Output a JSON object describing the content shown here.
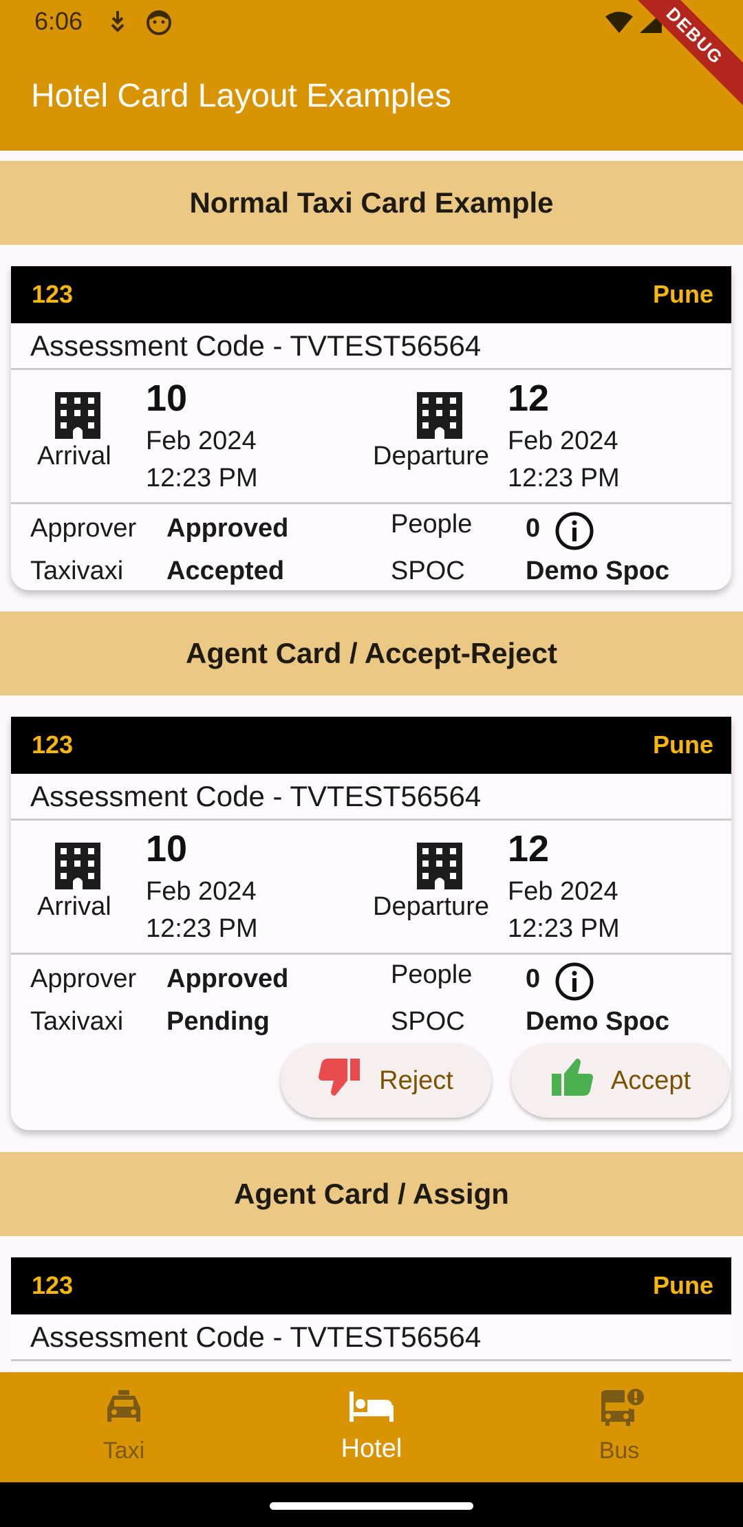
{
  "status": {
    "time": "6:06",
    "debug": "DEBUG"
  },
  "appbar": {
    "title": "Hotel Card Layout Examples"
  },
  "sections": [
    {
      "header": "Normal Taxi Card Example"
    },
    {
      "header": "Agent Card / Accept-Reject"
    },
    {
      "header": "Agent Card / Assign"
    }
  ],
  "cards": [
    {
      "number": "123",
      "city": "Pune",
      "assessment": "Assessment Code - TVTEST56564",
      "arrival": {
        "label": "Arrival",
        "day": "10",
        "month": "Feb 2024",
        "time": "12:23 PM"
      },
      "departure": {
        "label": "Departure",
        "day": "12",
        "month": "Feb 2024",
        "time": "12:23 PM"
      },
      "approver_label": "Approver",
      "approver_value": "Approved",
      "taxi_label": "Taxivaxi",
      "taxi_value": "Accepted",
      "people_label": "People",
      "people_value": "0",
      "spoc_label": "SPOC",
      "spoc_value": "Demo Spoc"
    },
    {
      "number": "123",
      "city": "Pune",
      "assessment": "Assessment Code - TVTEST56564",
      "arrival": {
        "label": "Arrival",
        "day": "10",
        "month": "Feb 2024",
        "time": "12:23 PM"
      },
      "departure": {
        "label": "Departure",
        "day": "12",
        "month": "Feb 2024",
        "time": "12:23 PM"
      },
      "approver_label": "Approver",
      "approver_value": "Approved",
      "taxi_label": "Taxivaxi",
      "taxi_value": "Pending",
      "people_label": "People",
      "people_value": "0",
      "spoc_label": "SPOC",
      "spoc_value": "Demo Spoc",
      "reject_label": "Reject",
      "accept_label": "Accept"
    },
    {
      "number": "123",
      "city": "Pune",
      "assessment": "Assessment Code - TVTEST56564"
    }
  ],
  "nav": {
    "items": [
      {
        "label": "Taxi",
        "icon": "taxi-icon"
      },
      {
        "label": "Hotel",
        "icon": "hotel-bed-icon"
      },
      {
        "label": "Bus",
        "icon": "bus-alert-icon"
      }
    ],
    "active": "Hotel"
  },
  "colors": {
    "accent": "#d99404",
    "header_band": "#ebc883",
    "card_top": "#000000",
    "badge_text": "#f6b70a"
  }
}
